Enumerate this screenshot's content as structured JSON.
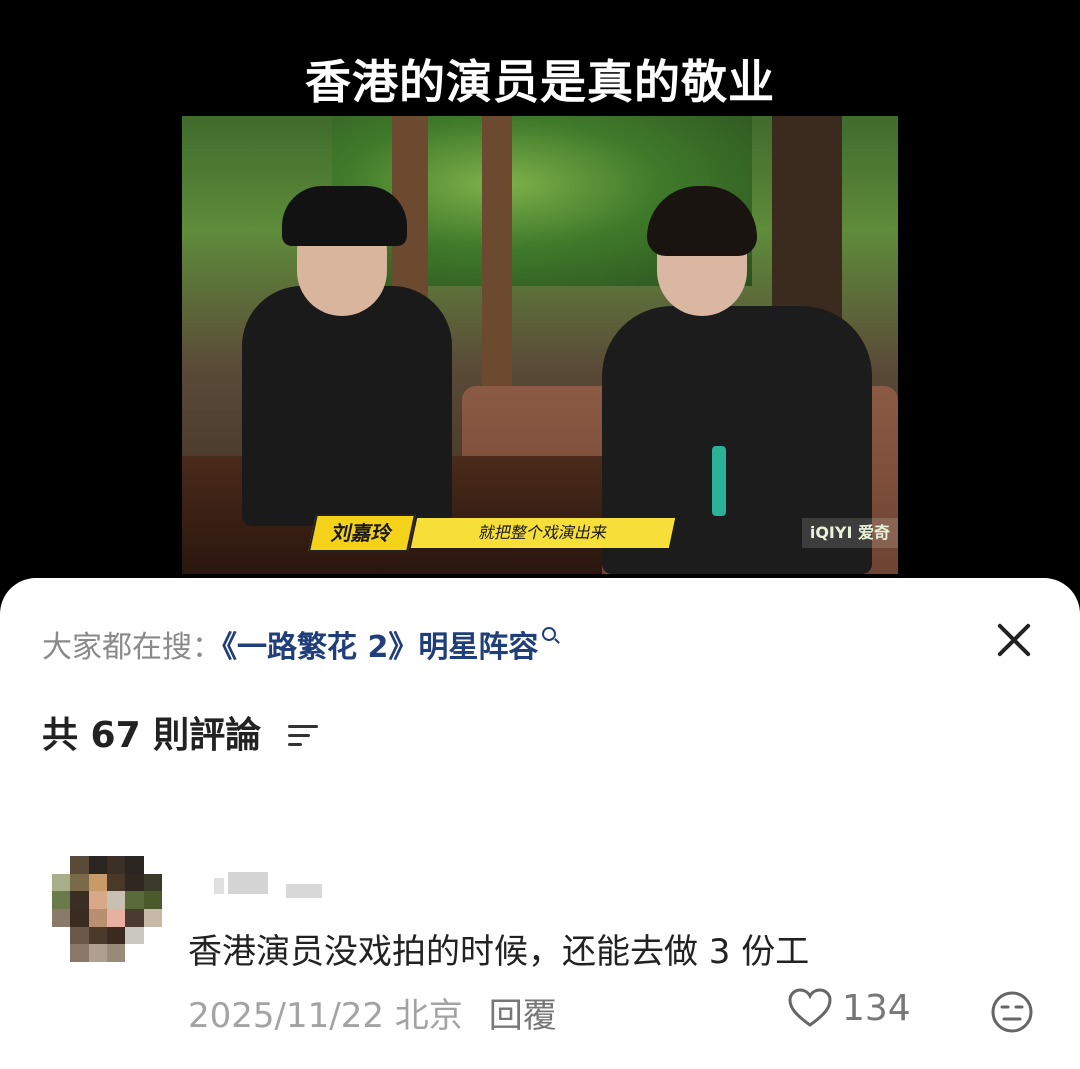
{
  "video": {
    "title": "香港的演员是真的敬业",
    "name_tag": "刘嘉玲",
    "subtitle": "就把整个戏演出来",
    "watermark": "iQIYI 爱奇"
  },
  "sheet": {
    "search_prefix": "大家都在搜：",
    "search_query": "《一路繁花 2》明星阵容",
    "comment_count_label": "共 67 則評論",
    "icons": [
      "search-icon",
      "close-icon",
      "sort-icon",
      "heart-icon",
      "face-reaction-icon"
    ]
  },
  "comment": {
    "text": "香港演员没戏拍的时候，还能去做 3 份工",
    "date_location": "2025/11/22 北京",
    "reply_label": "回覆",
    "likes": "134"
  },
  "colors": {
    "search_query": "#1f3e7a",
    "meta_text": "#a3a3a3",
    "name_tag_bg": "#f5d21a"
  }
}
